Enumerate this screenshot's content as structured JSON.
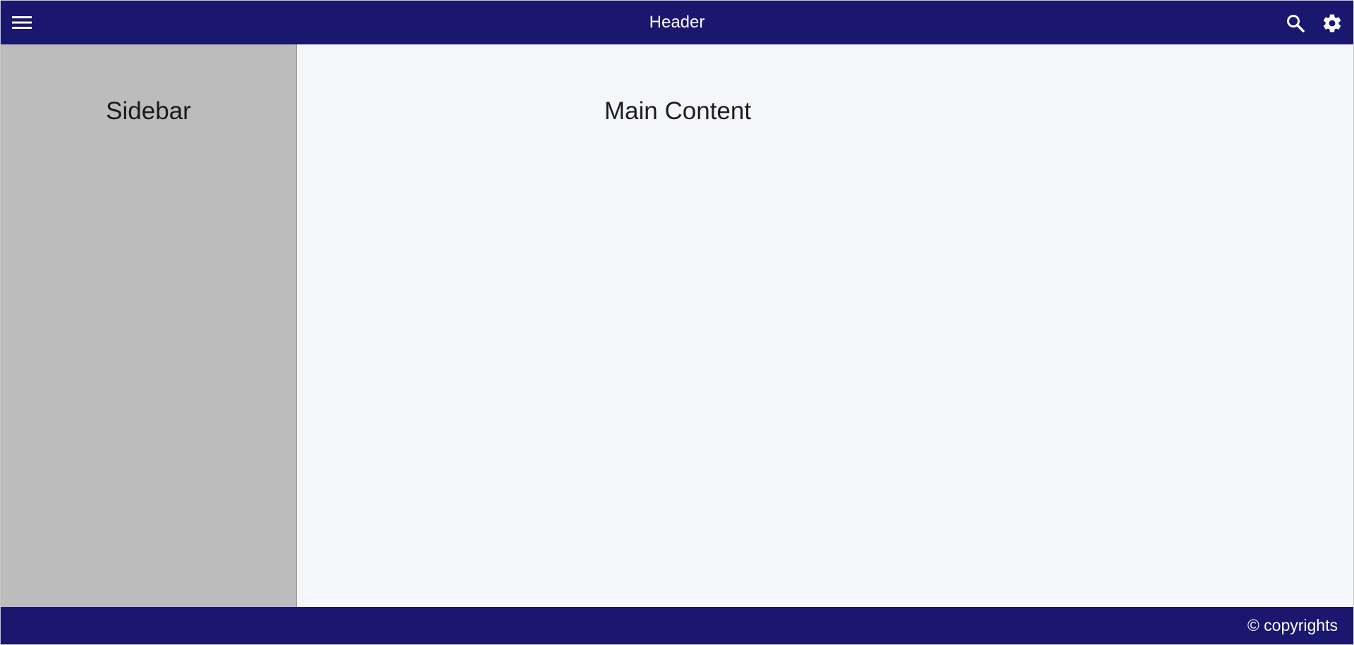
{
  "colors": {
    "header_bg": "#19176e",
    "footer_bg": "#19176e",
    "sidebar_bg": "#bcbcbc",
    "main_bg": "#f5f6fa",
    "header_text": "#ffffff"
  },
  "header": {
    "title": "Header",
    "icons": {
      "menu": "menu-icon",
      "search": "search-icon",
      "settings": "gear-icon"
    }
  },
  "sidebar": {
    "title": "Sidebar"
  },
  "main": {
    "title": "Main Content"
  },
  "footer": {
    "text": "© copyrights"
  }
}
